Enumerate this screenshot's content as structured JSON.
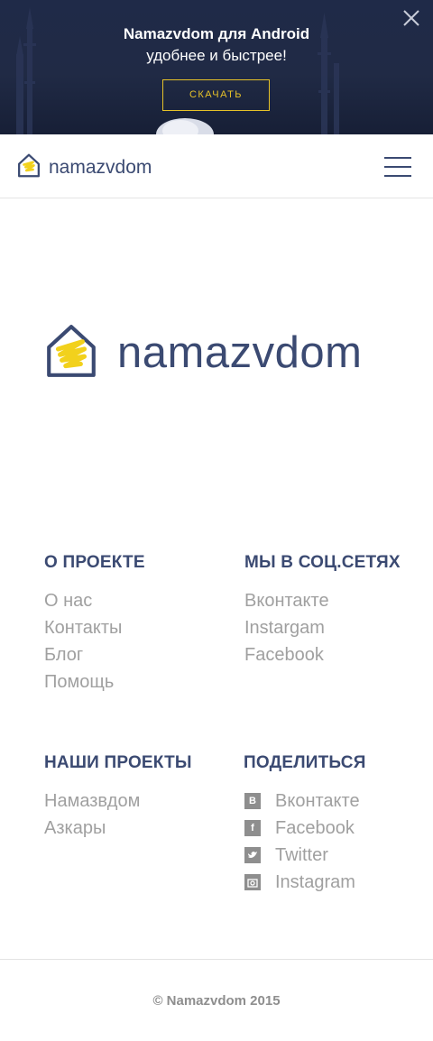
{
  "banner": {
    "title": "Namazvdom для Android",
    "subtitle": "удобнее и быстрее!",
    "download_label": "СКАЧАТЬ",
    "accent_color": "#e6c229",
    "close_icon": "close-icon"
  },
  "header": {
    "logo_text": "namazvdom",
    "logo_icon": "house-icon",
    "menu_icon": "hamburger-menu-icon"
  },
  "hero": {
    "logo_text": "namazvdom"
  },
  "footer": {
    "about": {
      "title": "О ПРОЕКТЕ",
      "items": [
        "О нас",
        "Контакты",
        "Блог",
        "Помощь"
      ]
    },
    "social": {
      "title": "МЫ В СОЦ.СЕТЯХ",
      "items": [
        "Вконтакте",
        "Instargam",
        "Facebook"
      ]
    },
    "projects": {
      "title": "НАШИ ПРОЕКТЫ",
      "items": [
        "Намазвдом",
        "Азкары"
      ]
    },
    "share": {
      "title": "ПОДЕЛИТЬСЯ",
      "items": [
        {
          "label": "Вконтакте",
          "icon": "vk-icon"
        },
        {
          "label": "Facebook",
          "icon": "facebook-icon"
        },
        {
          "label": "Twitter",
          "icon": "twitter-icon"
        },
        {
          "label": "Instagram",
          "icon": "instagram-icon"
        }
      ]
    },
    "copyright": "© Namazvdom 2015"
  },
  "colors": {
    "brand": "#3b4a72",
    "muted_text": "#a0a0a0",
    "logo_yellow": "#f2d11c"
  }
}
